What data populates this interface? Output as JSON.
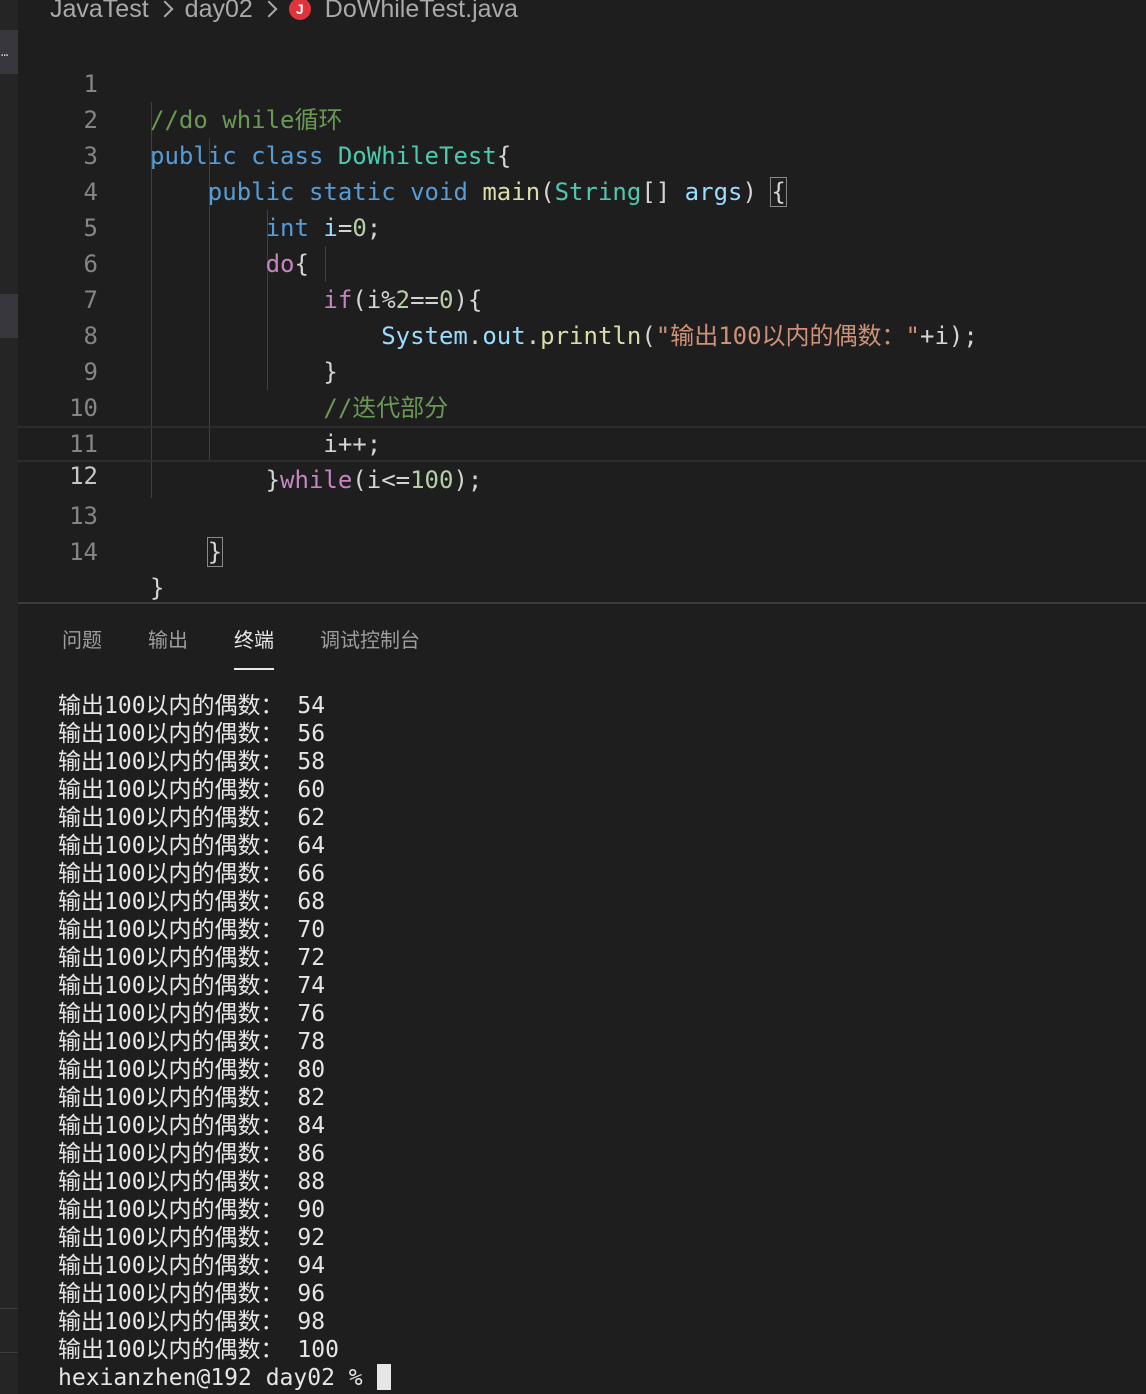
{
  "breadcrumb": {
    "folder1": "JavaTest",
    "folder2": "day02",
    "file_icon_letter": "J",
    "file": "DoWhileTest.java"
  },
  "editor": {
    "line_numbers": [
      "1",
      "2",
      "3",
      "4",
      "5",
      "6",
      "7",
      "8",
      "9",
      "10",
      "11",
      "12",
      "13",
      "14"
    ],
    "active_line": "12",
    "tokens": {
      "l1_comment": "//do while循环",
      "l2_public": "public",
      "l2_class": "class",
      "l2_name": "DoWhileTest",
      "l2_brace": "{",
      "l3_public": "public",
      "l3_static": "static",
      "l3_void": "void",
      "l3_main": "main",
      "l3_paren_open": "(",
      "l3_string": "String",
      "l3_arr": "[]",
      "l3_args": "args",
      "l3_paren_close": ")",
      "l3_brace": "{",
      "l4_int": "int",
      "l4_i": "i",
      "l4_eq": "=",
      "l4_zero": "0",
      "l4_semi": ";",
      "l5_do": "do",
      "l5_brace": "{",
      "l6_if": "if",
      "l6_open": "(i%",
      "l6_two": "2",
      "l6_eqeq": "==",
      "l6_zero": "0",
      "l6_close": "){",
      "l7_system": "System",
      "l7_dot1": ".",
      "l7_out": "out",
      "l7_dot2": ".",
      "l7_println": "println",
      "l7_paren": "(",
      "l7_string": "\"输出100以内的偶数：\"",
      "l7_rest": "+i);",
      "l8_brace": "}",
      "l9_comment": "//迭代部分",
      "l10_incr": "i++;",
      "l11_brace": "}",
      "l11_while": "while",
      "l11_open": "(i<=",
      "l11_num": "100",
      "l11_close": ");",
      "l13_brace": "}",
      "l14_brace": "}"
    }
  },
  "panel": {
    "tabs": [
      {
        "label": "问题"
      },
      {
        "label": "输出"
      },
      {
        "label": "终端"
      },
      {
        "label": "调试控制台"
      }
    ],
    "active_tab": "终端"
  },
  "terminal": {
    "lines": [
      "输出100以内的偶数： 54",
      "输出100以内的偶数： 56",
      "输出100以内的偶数： 58",
      "输出100以内的偶数： 60",
      "输出100以内的偶数： 62",
      "输出100以内的偶数： 64",
      "输出100以内的偶数： 66",
      "输出100以内的偶数： 68",
      "输出100以内的偶数： 70",
      "输出100以内的偶数： 72",
      "输出100以内的偶数： 74",
      "输出100以内的偶数： 76",
      "输出100以内的偶数： 78",
      "输出100以内的偶数： 80",
      "输出100以内的偶数： 82",
      "输出100以内的偶数： 84",
      "输出100以内的偶数： 86",
      "输出100以内的偶数： 88",
      "输出100以内的偶数： 90",
      "输出100以内的偶数： 92",
      "输出100以内的偶数： 94",
      "输出100以内的偶数： 96",
      "输出100以内的偶数： 98",
      "输出100以内的偶数： 100"
    ],
    "prompt": "hexianzhen@192 day02 % "
  },
  "colors": {
    "background": "#1e1e1e",
    "keyword": "#569cd6",
    "control": "#c586c0",
    "class": "#4ec9b0",
    "function": "#dcdcaa",
    "variable": "#9cdcfe",
    "number": "#b5cea8",
    "string": "#ce9178",
    "comment": "#6a9955",
    "java_icon": "#e0343c"
  },
  "icons": {
    "breadcrumb_separator": "chevron-right-icon",
    "file_icon": "java-file-icon",
    "activity_more": "more-icon"
  }
}
